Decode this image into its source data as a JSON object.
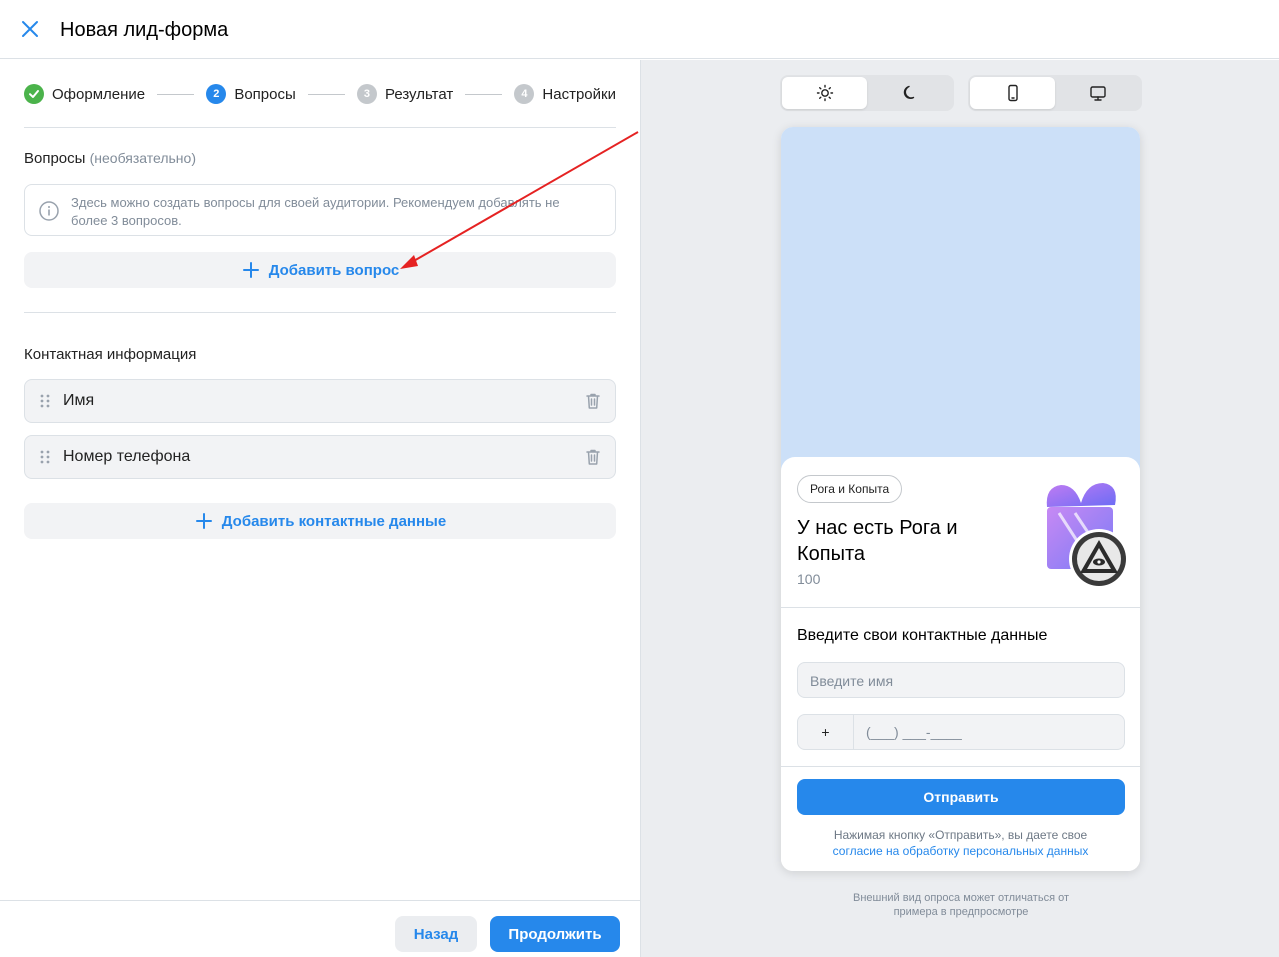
{
  "header": {
    "title": "Новая лид-форма",
    "close_icon": "close-icon"
  },
  "stepper": {
    "steps": [
      {
        "number": "1",
        "label": "Оформление",
        "state": "done"
      },
      {
        "number": "2",
        "label": "Вопросы",
        "state": "active"
      },
      {
        "number": "3",
        "label": "Результат",
        "state": "todo"
      },
      {
        "number": "4",
        "label": "Настройки",
        "state": "todo"
      }
    ]
  },
  "questions": {
    "title": "Вопросы",
    "optional": "(необязательно)",
    "info_text": "Здесь можно создать вопросы для своей аудитории. Рекомендуем добавлять не более 3 вопросов.",
    "add_label": "Добавить вопрос"
  },
  "contacts": {
    "title": "Контактная информация",
    "fields": [
      {
        "label": "Имя"
      },
      {
        "label": "Номер телефона"
      }
    ],
    "add_label": "Добавить контактные данные"
  },
  "footer": {
    "back_label": "Назад",
    "continue_label": "Продолжить"
  },
  "preview": {
    "theme_modes": [
      "sun-icon",
      "moon-icon"
    ],
    "device_modes": [
      "mobile-icon",
      "desktop-icon"
    ],
    "brand": "Рога и Копыта",
    "promo_title": "У нас есть Рога и Копыта",
    "promo_value": "100",
    "form_title": "Введите свои контактные данные",
    "name_placeholder": "Введите имя",
    "phone_prefix": "+",
    "phone_mask": "(___) ___-____",
    "submit_label": "Отправить",
    "consent_text": "Нажимая кнопку «Отправить», вы даете свое",
    "consent_link": "согласие на обработку персональных данных",
    "note": "Внешний вид опроса может отличаться от примера в предпросмотре"
  },
  "colors": {
    "accent": "#2688eb",
    "success": "#4bb34b",
    "cover": "#cce0f8",
    "annotation_arrow": "#e52222"
  }
}
